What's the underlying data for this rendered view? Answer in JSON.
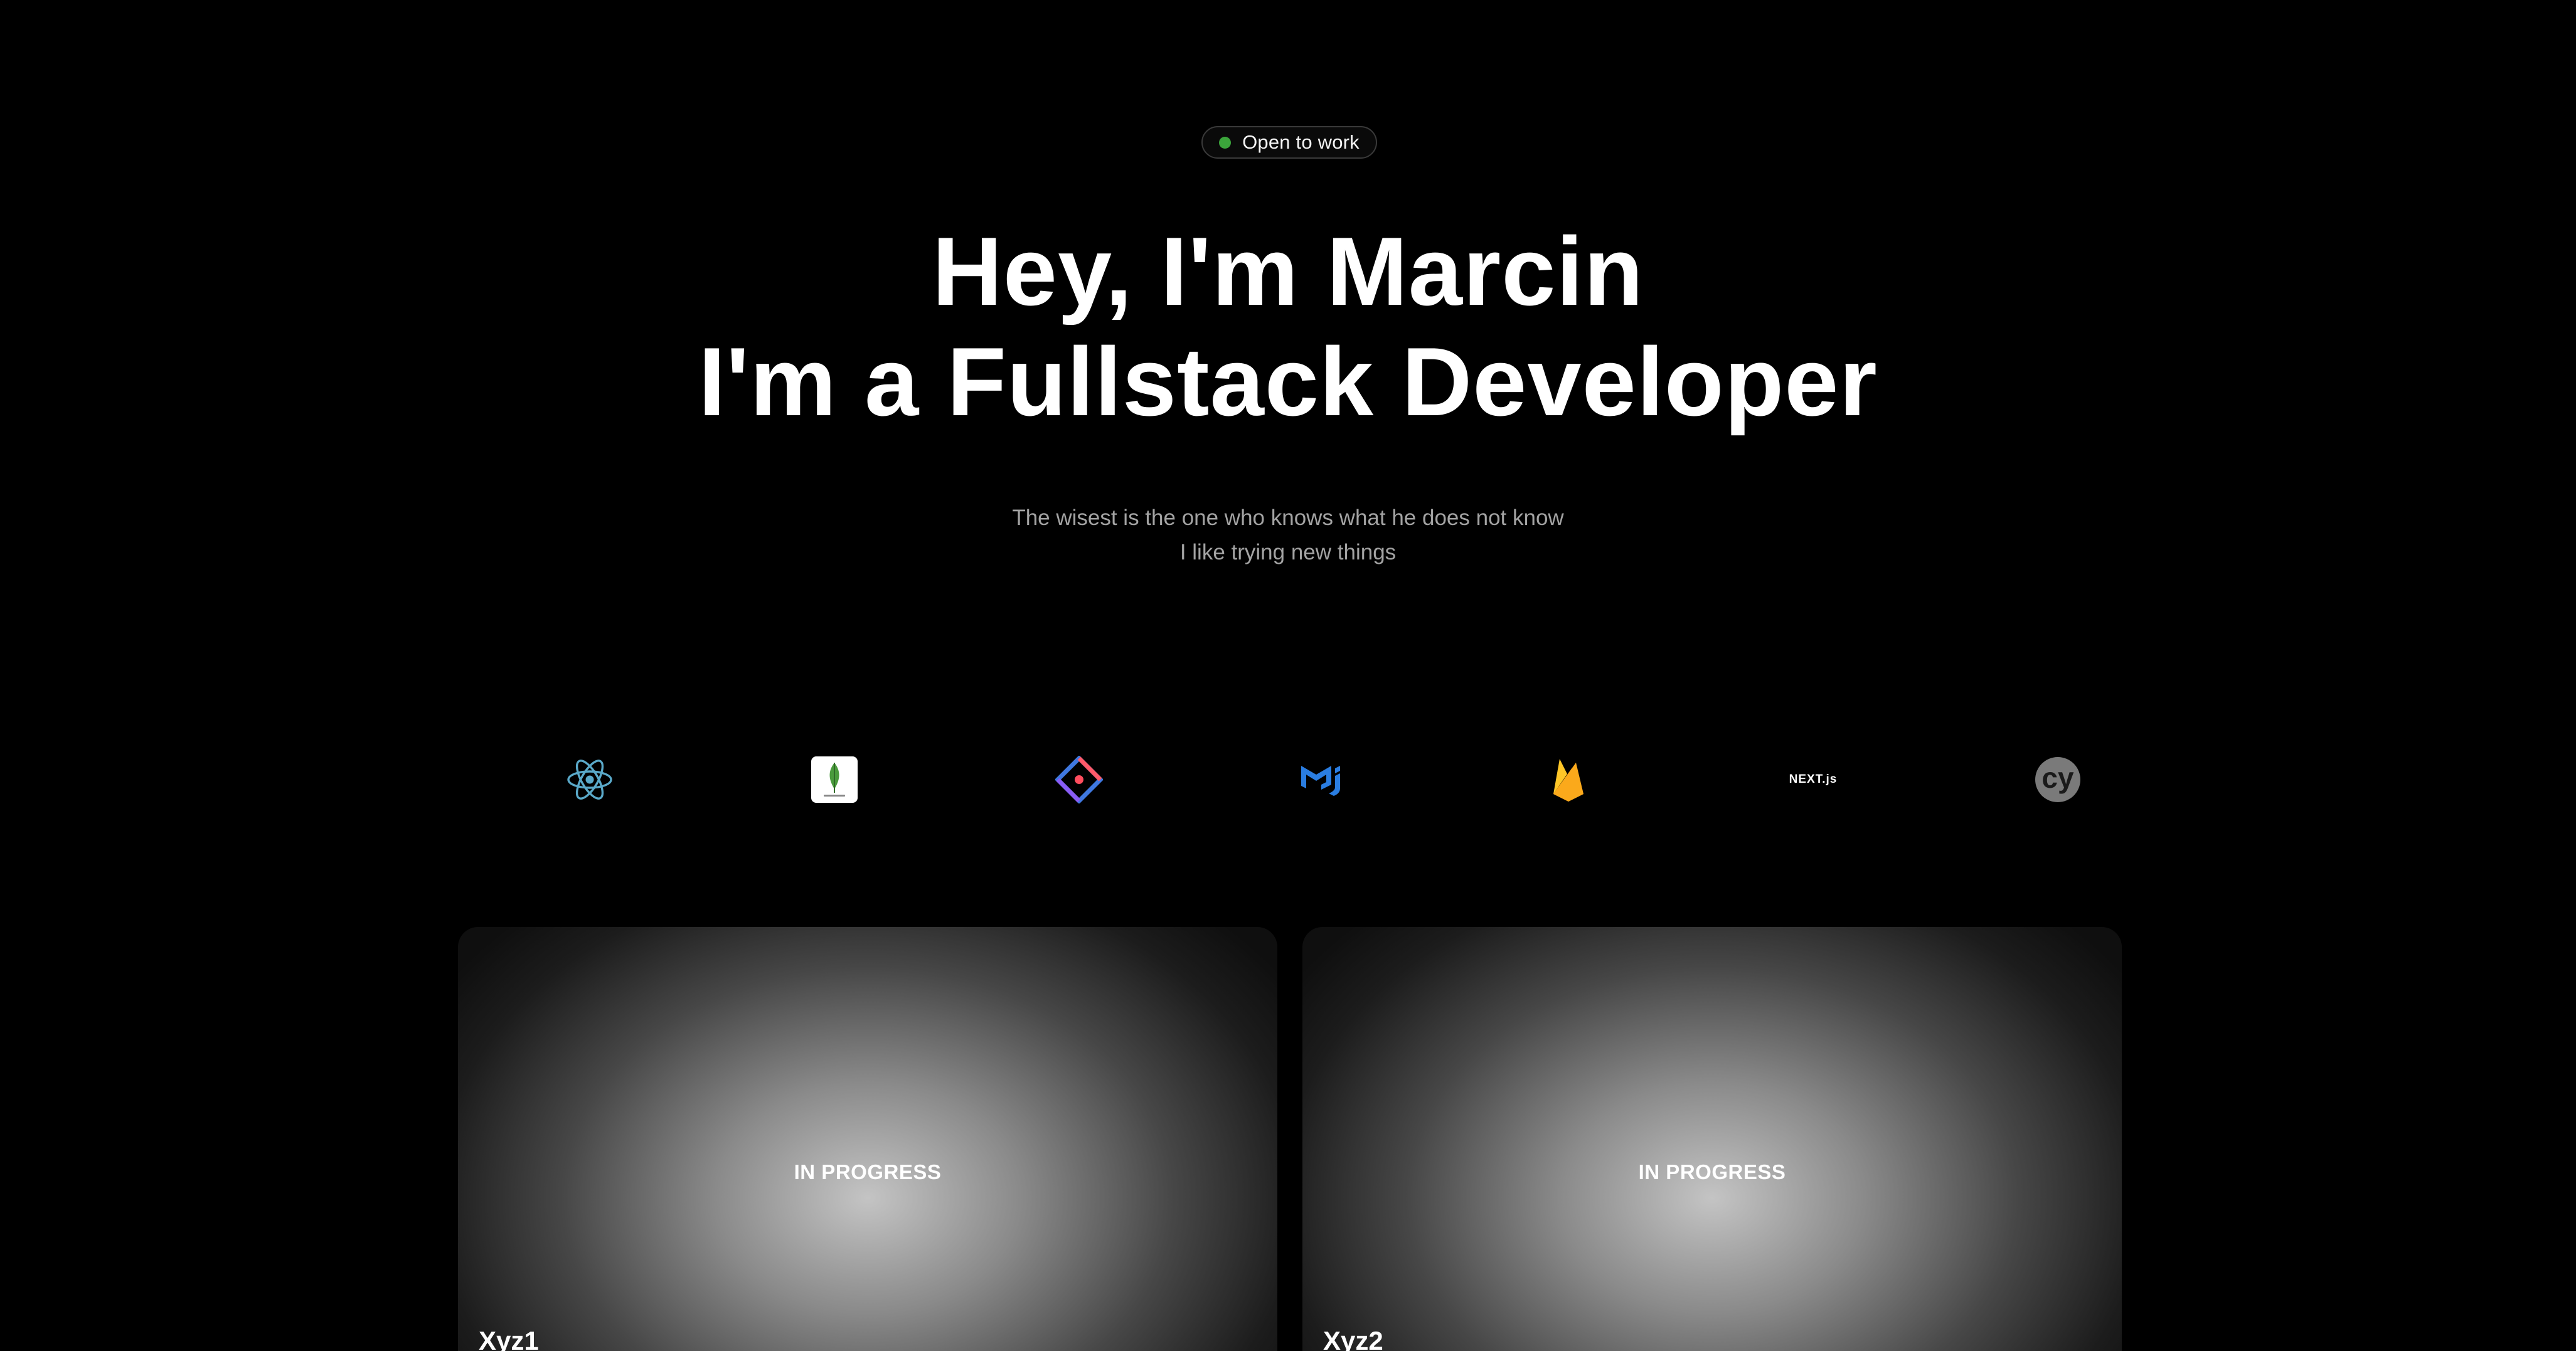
{
  "status": {
    "label": "Open to work",
    "dot_color": "#3ba53b"
  },
  "hero": {
    "line1": "Hey, I'm Marcin",
    "line2": "I'm a Fullstack Developer"
  },
  "tagline": {
    "line1": "The wisest is the one who knows what he does not know",
    "line2": "I like trying new things"
  },
  "tech_logos": [
    {
      "icon": "react-icon"
    },
    {
      "icon": "mongodb-icon"
    },
    {
      "icon": "jira-icon"
    },
    {
      "icon": "material-ui-icon"
    },
    {
      "icon": "firebase-icon"
    },
    {
      "icon": "nextjs-icon",
      "text": "NEXT.js"
    },
    {
      "icon": "cypress-icon",
      "text": "cy"
    }
  ],
  "projects": [
    {
      "status": "IN PROGRESS",
      "title": "Xyz1"
    },
    {
      "status": "IN PROGRESS",
      "title": "Xyz2"
    }
  ],
  "colors": {
    "background": "#000000",
    "text": "#ffffff",
    "muted_text": "#a3a3a3",
    "accent_green": "#3ba53b"
  }
}
